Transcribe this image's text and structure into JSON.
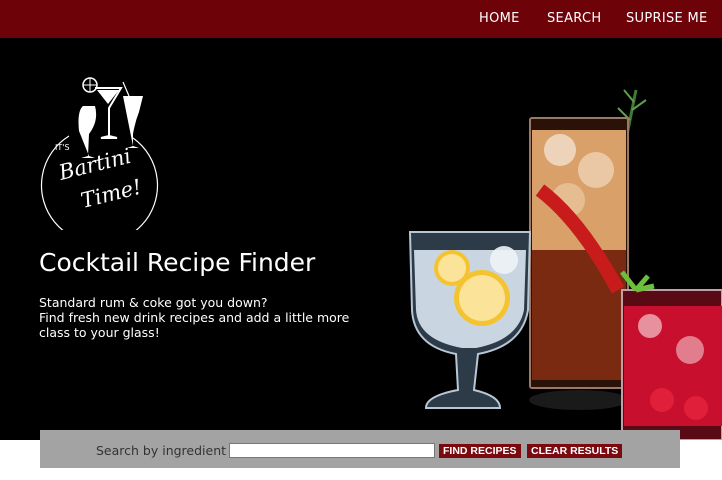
{
  "nav": {
    "items": [
      {
        "label": "HOME"
      },
      {
        "label": "SEARCH"
      },
      {
        "label": "SUPRISE ME"
      }
    ]
  },
  "logo": {
    "small_text": "IT'S",
    "line1": "Bartini",
    "line2": "Time!"
  },
  "hero": {
    "title": "Cocktail Recipe Finder",
    "subtitle_lines": [
      "Standard rum & coke got you down?",
      "Find fresh new drink recipes and add a little more",
      "class to your glass!"
    ]
  },
  "search": {
    "label": "Search by ingredient",
    "value": "",
    "find_label": "FIND RECIPES",
    "clear_label": "CLEAR RESULTS"
  },
  "colors": {
    "nav_bg": "#6e0209",
    "hero_bg": "#000000",
    "search_bg": "#a3a3a3",
    "button_bg": "#7a0a10"
  }
}
